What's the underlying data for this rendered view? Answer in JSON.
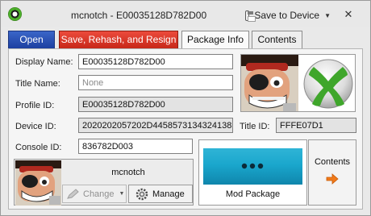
{
  "window": {
    "title": "mcnotch - E00035128D782D00",
    "save_to_device_label": "Save to Device",
    "close_glyph": "✕"
  },
  "tabs": [
    {
      "label": "Open",
      "color": "#2a51b5"
    },
    {
      "label": "Save, Rehash, and Resign",
      "color": "#d8372a"
    },
    {
      "label": "Package Info",
      "selected": true
    },
    {
      "label": "Contents"
    }
  ],
  "form": {
    "display_name": {
      "label": "Display Name:",
      "value": "E00035128D782D00"
    },
    "title_name": {
      "label": "Title Name:",
      "value": "",
      "placeholder": "None"
    },
    "profile_id": {
      "label": "Profile ID:",
      "value": "E00035128D782D00"
    },
    "device_id": {
      "label": "Device ID:",
      "value": "2020202057202D44585731343241383"
    },
    "title_id": {
      "label": "Title ID:",
      "value": "FFFE07D1"
    },
    "console_id": {
      "label": "Console ID:",
      "value": "836782D003"
    }
  },
  "profile": {
    "gamertag": "mcnotch",
    "change_label": "Change",
    "manage_label": "Manage"
  },
  "mod_package": {
    "label": "Mod Package",
    "thumbnail_color": "#1fa9cf"
  },
  "contents_button": {
    "label": "Contents",
    "arrow_color": "#f07a1a"
  },
  "icons": {
    "app": "xbox-logo-icon",
    "save": "floppy-disk-icon",
    "change": "pencil-icon",
    "manage": "gear-icon",
    "contents": "arrow-right-icon",
    "title_image": "xbox-logo-icon",
    "gamerpic": "pirate-gamerpic"
  }
}
